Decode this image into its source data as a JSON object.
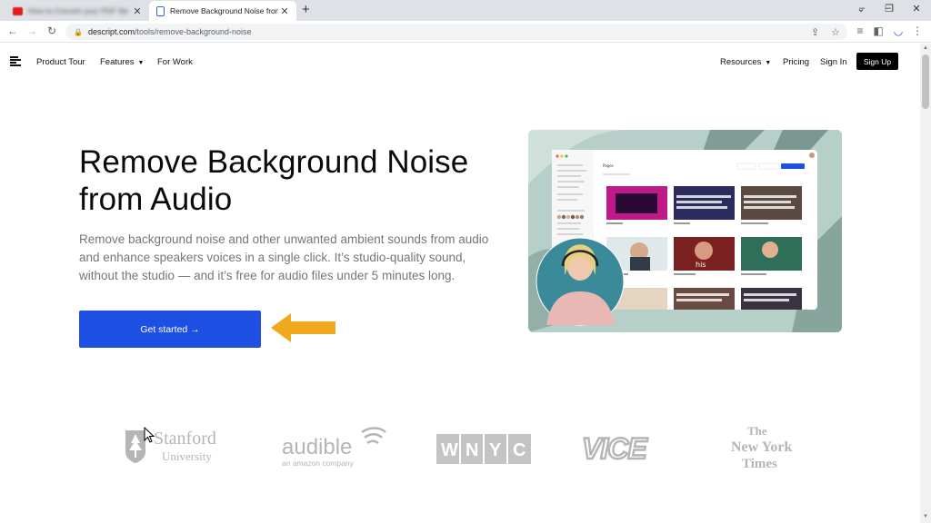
{
  "browser": {
    "tabs": [
      {
        "title": "How to Convert your PDF file to ...",
        "active": false
      },
      {
        "title": "Remove Background Noise from",
        "active": true
      }
    ],
    "url_host": "descript.com",
    "url_path": "/tools/remove-background-noise",
    "new_tab_symbol": "+",
    "window_controls": [
      "‒",
      "❐",
      "✕"
    ]
  },
  "nav": {
    "product_tour": "Product Tour",
    "features": "Features",
    "for_work": "For Work",
    "resources": "Resources",
    "pricing": "Pricing",
    "sign_in": "Sign In",
    "sign_up": "Sign Up"
  },
  "hero": {
    "title_line1": "Remove Background Noise",
    "title_line2": "from Audio",
    "description": "Remove background noise and other unwanted ambient sounds from audio and enhance speakers voices in a single click. It’s studio-quality sound, without the studio — and it’s free for audio files under 5 minutes long.",
    "cta": "Get started →"
  },
  "screenshot": {
    "app_header": "Pages",
    "search_label": "Search",
    "new_folder": "New Folder",
    "new_project": "+ New Project",
    "card_caption": "his"
  },
  "logos": {
    "stanford_line1": "Stanford",
    "stanford_line2": "University",
    "audible": "audible",
    "audible_sub": "an amazon company",
    "wnyc": [
      "W",
      "N",
      "Y",
      "C"
    ],
    "vice": "VICE",
    "nyt_line1": "The",
    "nyt_line2": "New York",
    "nyt_line3": "Times"
  },
  "colors": {
    "cta": "#1d4fe3",
    "arrow": "#f0a81c",
    "signup_bg": "#000000",
    "logo_gray": "#b5b5b5"
  }
}
